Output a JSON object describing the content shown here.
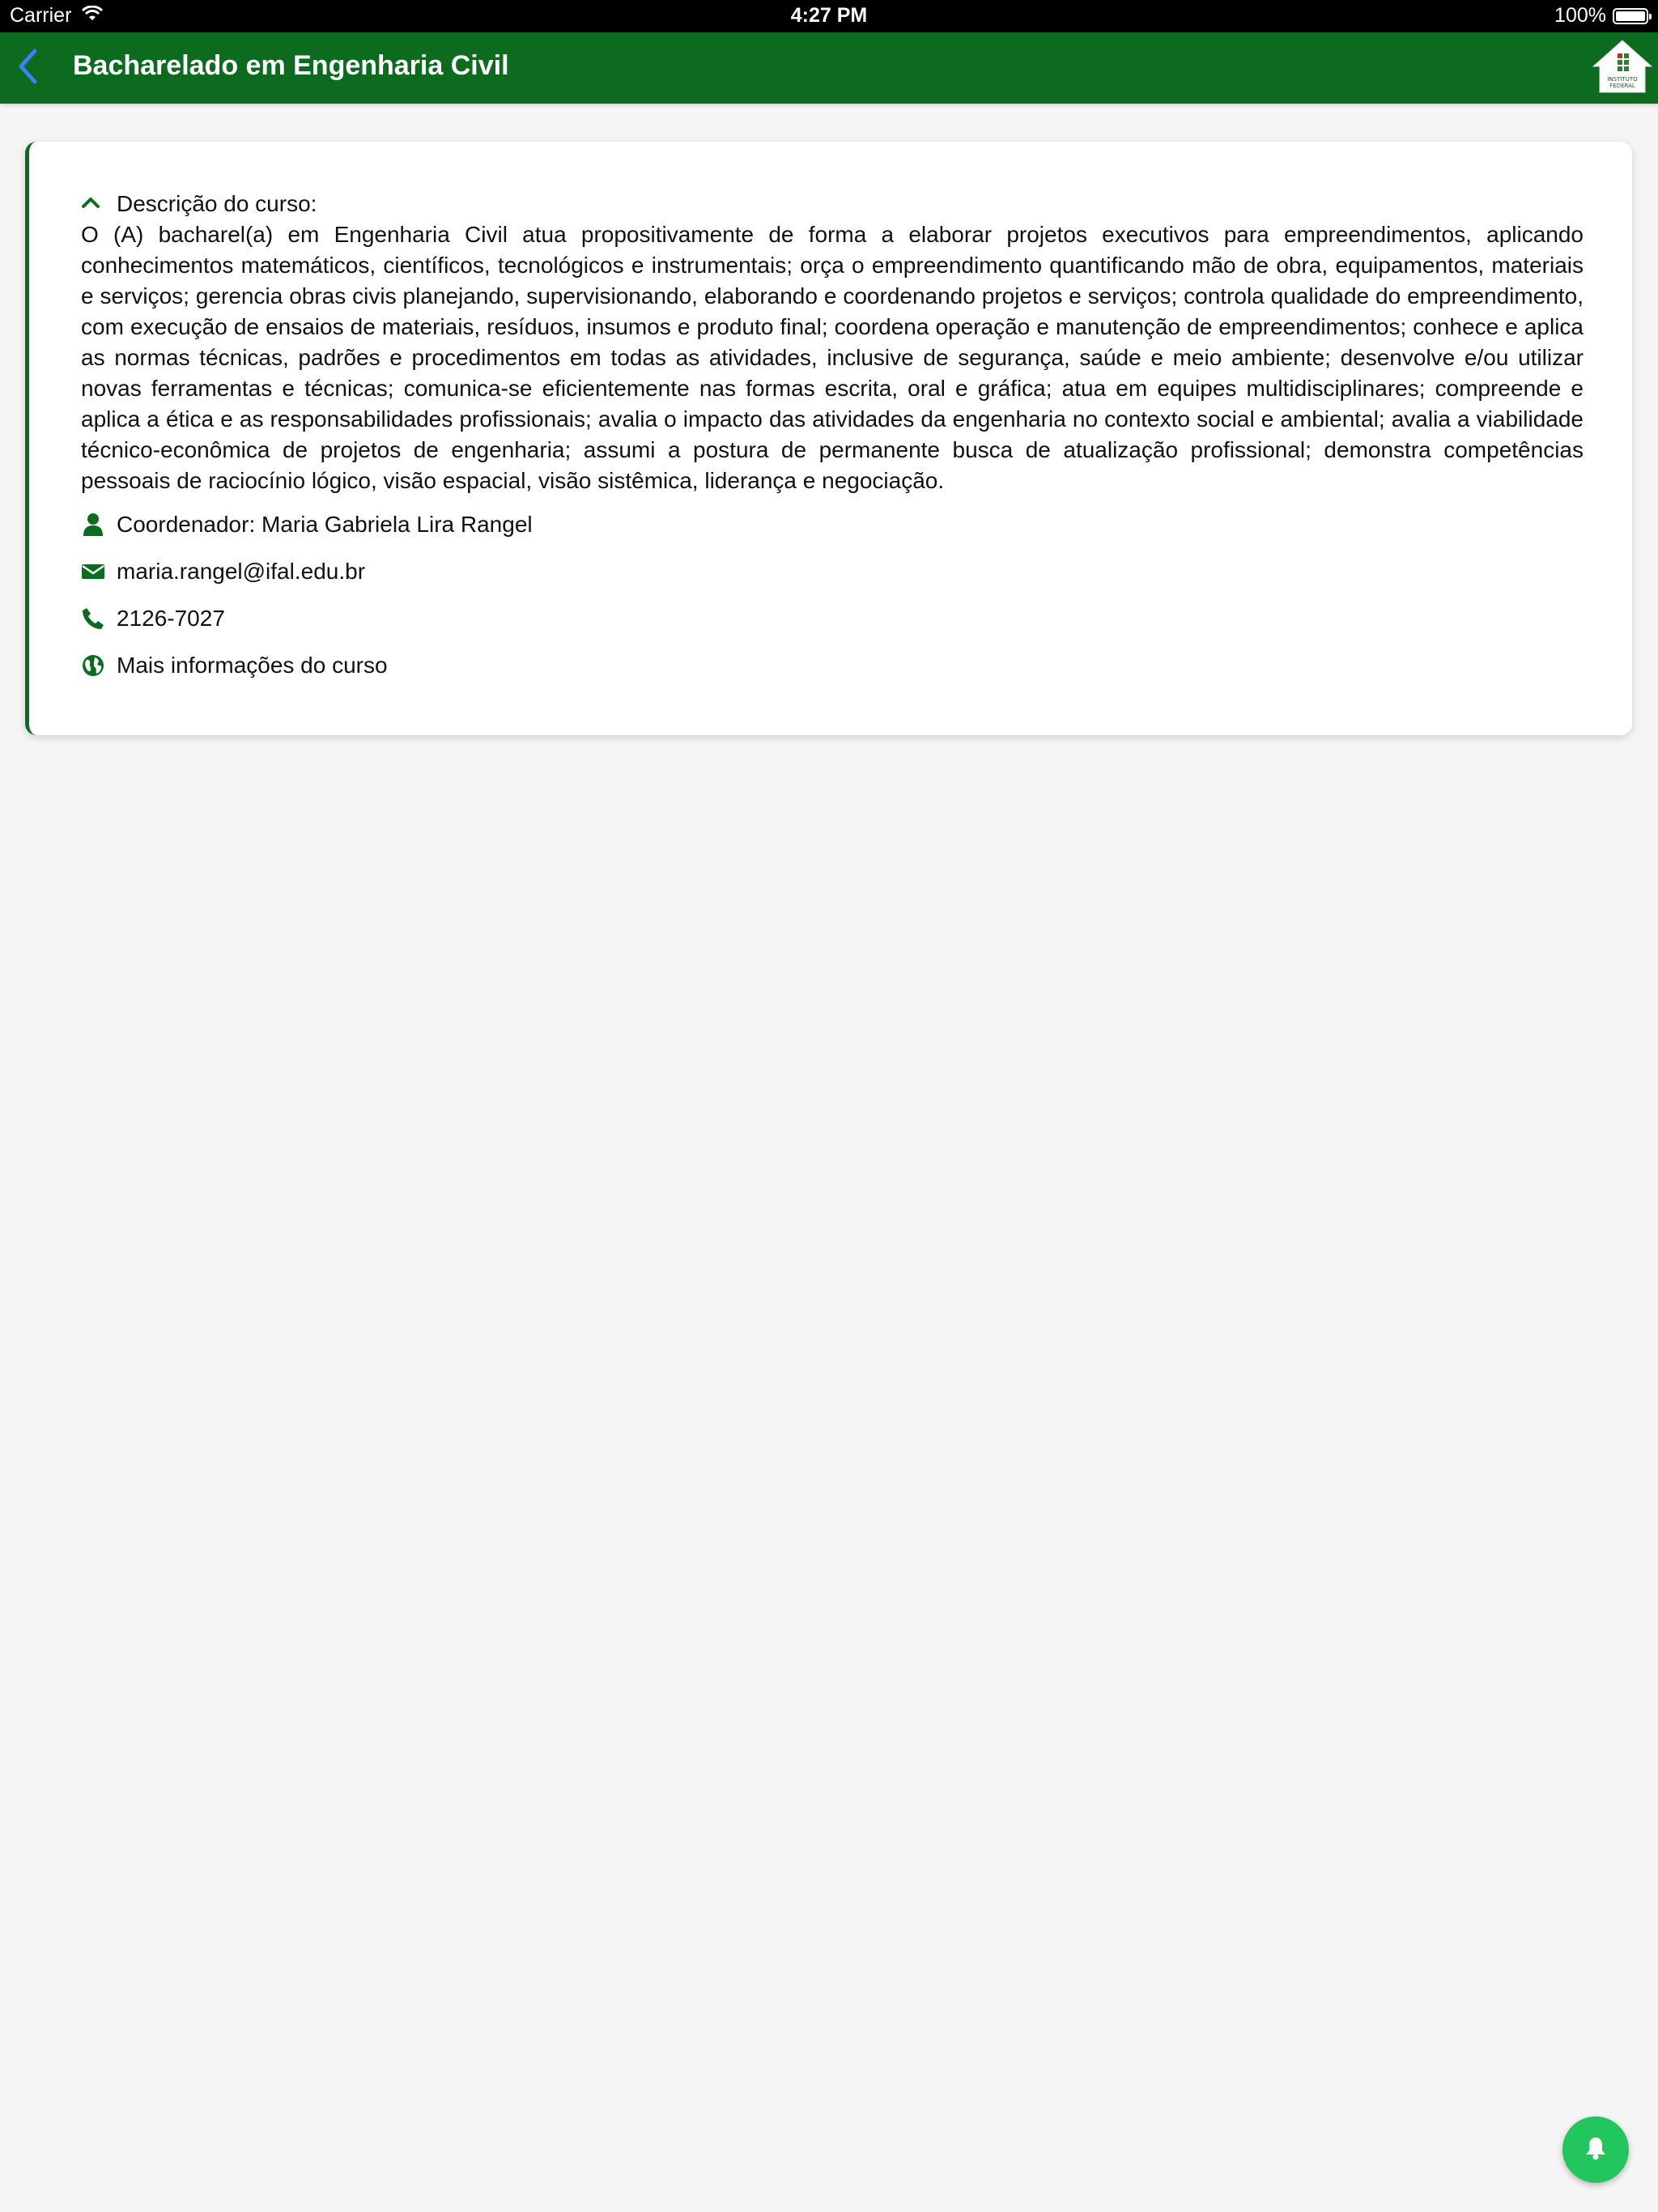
{
  "status_bar": {
    "carrier": "Carrier",
    "time": "4:27 PM",
    "battery_percent": "100%",
    "battery_level": 1.0
  },
  "header": {
    "title": "Bacharelado em Engenharia Civil",
    "back_icon": "chevron-left-icon",
    "logo_icon": "instituto-federal-home-logo",
    "logo_text_line1": "INSTITUTO",
    "logo_text_line2": "FEDERAL"
  },
  "course": {
    "description_label": "Descrição do curso:",
    "description_toggle_icon": "chevron-up-icon",
    "description": "O (A) bacharel(a) em Engenharia Civil atua propositivamente de forma a elaborar projetos executivos para empreendimentos, aplicando conhecimentos matemáticos, científicos, tecnológicos e instrumentais; orça o empreendimento quantificando mão de obra, equipamentos, materiais e serviços; gerencia obras civis planejando, supervisionando, elaborando e coordenando projetos e serviços; controla qualidade do empreendimento, com execução de ensaios de materiais, resíduos, insumos e produto final; coordena operação e manutenção de empreendimentos; conhece e aplica as normas técnicas, padrões e procedimentos em todas as atividades, inclusive de segurança, saúde e meio ambiente; desenvolve e/ou utilizar novas ferramentas e técnicas; comunica-se eficientemente nas formas escrita, oral e gráfica; atua em equipes multidisciplinares; compreende e aplica a ética e as responsabilidades profissionais; avalia o impacto das atividades da engenharia no contexto social e ambiental; avalia a viabilidade técnico-econômica de projetos de engenharia; assumi a postura de permanente busca de atualização profissional; demonstra competências pessoais de raciocínio lógico, visão espacial, visão sistêmica, liderança e negociação.",
    "coordinator": "Coordenador: Maria Gabriela Lira Rangel",
    "email": "maria.rangel@ifal.edu.br",
    "phone": "2126-7027",
    "more_info": "Mais informações do curso"
  },
  "icons": {
    "coordinator": "user-icon",
    "email": "envelope-icon",
    "phone": "phone-icon",
    "more_info": "globe-icon",
    "fab": "bell-icon"
  },
  "colors": {
    "brand_green": "#0c6b1f",
    "icon_green": "#0c6b1f",
    "fab_green": "#22c55e",
    "back_blue": "#3b82f6",
    "background": "#f5f5f5"
  }
}
